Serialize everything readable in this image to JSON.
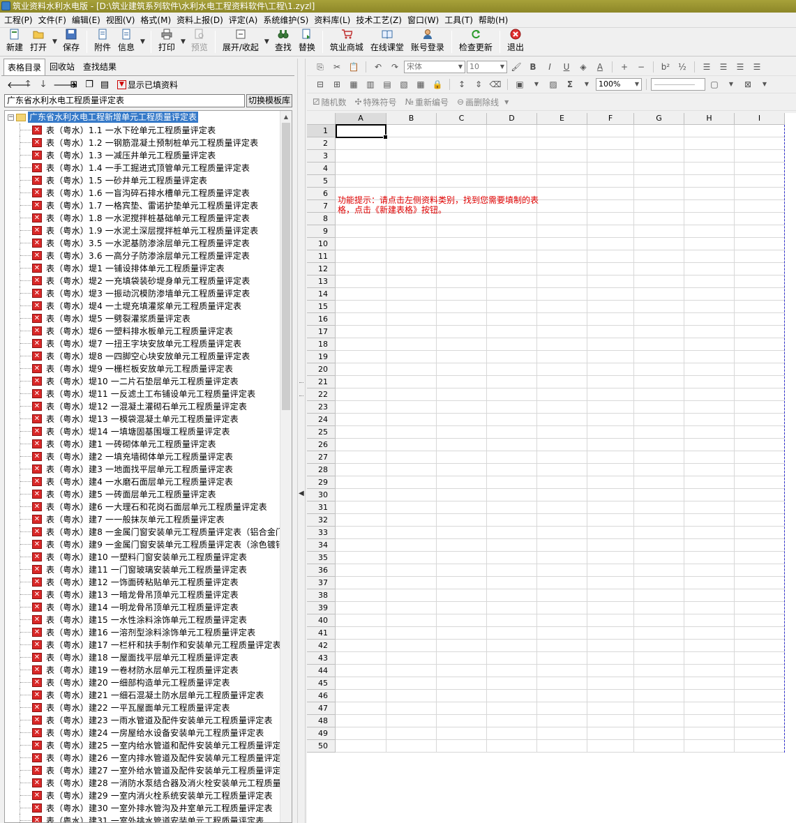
{
  "window": {
    "title": "筑业资料水利水电版 - [D:\\筑业建筑系列软件\\水利水电工程资料软件\\工程\\1.zyzl]"
  },
  "menu": [
    "工程(P)",
    "文件(F)",
    "编辑(E)",
    "视图(V)",
    "格式(M)",
    "资料上报(D)",
    "评定(A)",
    "系统维护(S)",
    "资料库(L)",
    "技术工艺(Z)",
    "窗口(W)",
    "工具(T)",
    "帮助(H)"
  ],
  "toolbar": {
    "new": "新建",
    "open": "打开",
    "save": "保存",
    "attach": "附件",
    "info": "信息",
    "print": "打印",
    "preview": "预览",
    "expand": "展开/收起",
    "find": "查找",
    "replace": "替换",
    "mall": "筑业商城",
    "classroom": "在线课堂",
    "login": "账号登录",
    "update": "检查更新",
    "exit": "退出"
  },
  "left": {
    "tabs": [
      "表格目录",
      "回收站",
      "查找结果"
    ],
    "show_filled": "显示已填资料",
    "template_combo": "广东省水利水电工程质量评定表",
    "switch_template": "切换模板库",
    "root": "广东省水利水电工程新增单元工程质量评定表",
    "items": [
      "表（粤水）1.1 一水下砼单元工程质量评定表",
      "表（粤水）1.2 一钢筋混凝土预制桩单元工程质量评定表",
      "表（粤水）1.3 一减压井单元工程质量评定表",
      "表（粤水）1.4 一手工掘进式顶管单元工程质量评定表",
      "表（粤水）1.5 一砂井单元工程质量评定表",
      "表（粤水）1.6 一盲沟碎石排水槽单元工程质量评定表",
      "表（粤水）1.7 一格宾垫、雷诺护垫单元工程质量评定表",
      "表（粤水）1.8 一水泥搅拌桩基础单元工程质量评定表",
      "表（粤水）1.9 一水泥土深层搅拌桩单元工程质量评定表",
      "表（粤水）3.5 一水泥基防渗涂层单元工程质量评定表",
      "表（粤水）3.6 一高分子防渗涂层单元工程质量评定表",
      "表（粤水）堤1 一铺设排体单元工程质量评定表",
      "表（粤水）堤2 一充填袋装砂堤身单元工程质量评定表",
      "表（粤水）堤3 一振动沉模防渗墙单元工程质量评定表",
      "表（粤水）堤4 一土堤充填灌浆单元工程质量评定表",
      "表（粤水）堤5 一劈裂灌浆质量评定表",
      "表（粤水）堤6 一塑料排水板单元工程质量评定表",
      "表（粤水）堤7 一扭王字块安放单元工程质量评定表",
      "表（粤水）堤8 一四脚空心块安放单元工程质量评定表",
      "表（粤水）堤9 一栅栏板安放单元工程质量评定表",
      "表（粤水）堤10 一二片石垫层单元工程质量评定表",
      "表（粤水）堤11 一反滤土工布铺设单元工程质量评定表",
      "表（粤水）堤12 一混凝土灌砌石单元工程质量评定表",
      "表（粤水）堤13 一模袋混凝土单元工程质量评定表",
      "表（粤水）堤14 一填塘固基围堰工程质量评定表",
      "表（粤水）建1 一砖砌体单元工程质量评定表",
      "表（粤水）建2 一填充墙砌体单元工程质量评定表",
      "表（粤水）建3 一地面找平层单元工程质量评定表",
      "表（粤水）建4 一水磨石面层单元工程质量评定表",
      "表（粤水）建5 一砖面层单元工程质量评定表",
      "表（粤水）建6 一大理石和花岗石面层单元工程质量评定表",
      "表（粤水）建7 一一般抹灰单元工程质量评定表",
      "表（粤水）建8 一金属门窗安装单元工程质量评定表（铝合金门",
      "表（粤水）建9 一金属门窗安装单元工程质量评定表（涂色镀锌",
      "表（粤水）建10 一塑料门窗安装单元工程质量评定表",
      "表（粤水）建11 一门窗玻璃安装单元工程质量评定表",
      "表（粤水）建12 一饰面砖粘贴单元工程质量评定表",
      "表（粤水）建13 一暗龙骨吊顶单元工程质量评定表",
      "表（粤水）建14 一明龙骨吊顶单元工程质量评定表",
      "表（粤水）建15 一水性涂料涂饰单元工程质量评定表",
      "表（粤水）建16 一溶剂型涂料涂饰单元工程质量评定表",
      "表（粤水）建17 一栏杆和扶手制作和安装单元工程质量评定表",
      "表（粤水）建18 一屋面找平层单元工程质量评定表",
      "表（粤水）建19 一卷材防水层单元工程质量评定表",
      "表（粤水）建20 一细部构造单元工程质量评定表",
      "表（粤水）建21 一细石混凝土防水层单元工程质量评定表",
      "表（粤水）建22 一平瓦屋面单元工程质量评定表",
      "表（粤水）建23 一雨水管道及配件安装单元工程质量评定表",
      "表（粤水）建24 一房屋给水设备安装单元工程质量评定表",
      "表（粤水）建25 一室内给水管道和配件安装单元工程质量评定:",
      "表（粤水）建26 一室内排水管道及配件安装单元工程质量评定:",
      "表（粤水）建27 一室外给水管道及配件安装单元工程质量评定:",
      "表（粤水）建28 一消防水泵结合器及消火栓安装单元工程质量'",
      "表（粤水）建29 一室内消火栓系统安装单元工程质量评定表",
      "表（粤水）建30 一室外排水管沟及井室单元工程质量评定表",
      "表（粤水）建31 一室外排水管道安装单元工程质量评定表"
    ]
  },
  "format": {
    "font_name": "宋体",
    "font_size": "10",
    "zoom": "100%",
    "random": "随机数",
    "special": "特殊符号",
    "renumber": "重新编号",
    "strike": "画删除线"
  },
  "sheet": {
    "columns": [
      "A",
      "B",
      "C",
      "D",
      "E",
      "F",
      "G",
      "H",
      "I"
    ],
    "row_count": 50,
    "hint": "功能提示：请点击左侧资料类别，找到您需要填制的表格，点击《新建表格》按钮。"
  },
  "colors": {
    "title_bg": "#a7a13a",
    "selection": "#3579c8",
    "hint_red": "#e00000",
    "table_icon_red": "#d92828"
  }
}
